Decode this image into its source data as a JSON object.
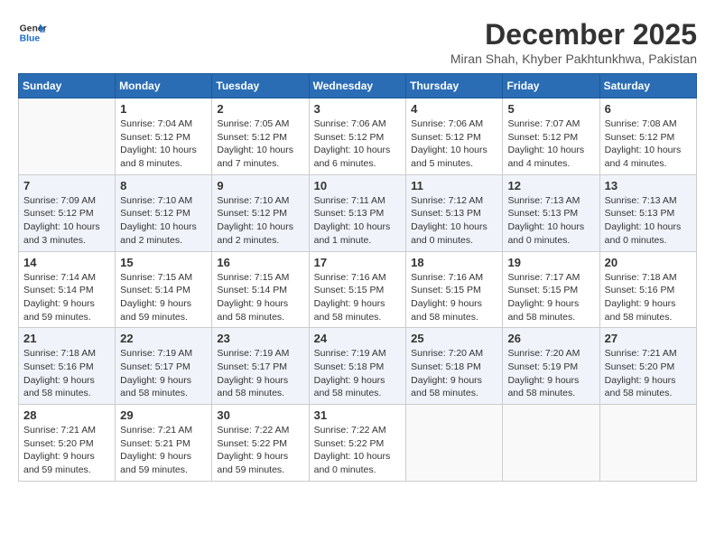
{
  "logo": {
    "line1": "General",
    "line2": "Blue"
  },
  "title": "December 2025",
  "subtitle": "Miran Shah, Khyber Pakhtunkhwa, Pakistan",
  "days_of_week": [
    "Sunday",
    "Monday",
    "Tuesday",
    "Wednesday",
    "Thursday",
    "Friday",
    "Saturday"
  ],
  "weeks": [
    [
      {
        "day": "",
        "info": ""
      },
      {
        "day": "1",
        "info": "Sunrise: 7:04 AM\nSunset: 5:12 PM\nDaylight: 10 hours\nand 8 minutes."
      },
      {
        "day": "2",
        "info": "Sunrise: 7:05 AM\nSunset: 5:12 PM\nDaylight: 10 hours\nand 7 minutes."
      },
      {
        "day": "3",
        "info": "Sunrise: 7:06 AM\nSunset: 5:12 PM\nDaylight: 10 hours\nand 6 minutes."
      },
      {
        "day": "4",
        "info": "Sunrise: 7:06 AM\nSunset: 5:12 PM\nDaylight: 10 hours\nand 5 minutes."
      },
      {
        "day": "5",
        "info": "Sunrise: 7:07 AM\nSunset: 5:12 PM\nDaylight: 10 hours\nand 4 minutes."
      },
      {
        "day": "6",
        "info": "Sunrise: 7:08 AM\nSunset: 5:12 PM\nDaylight: 10 hours\nand 4 minutes."
      }
    ],
    [
      {
        "day": "7",
        "info": "Sunrise: 7:09 AM\nSunset: 5:12 PM\nDaylight: 10 hours\nand 3 minutes."
      },
      {
        "day": "8",
        "info": "Sunrise: 7:10 AM\nSunset: 5:12 PM\nDaylight: 10 hours\nand 2 minutes."
      },
      {
        "day": "9",
        "info": "Sunrise: 7:10 AM\nSunset: 5:12 PM\nDaylight: 10 hours\nand 2 minutes."
      },
      {
        "day": "10",
        "info": "Sunrise: 7:11 AM\nSunset: 5:13 PM\nDaylight: 10 hours\nand 1 minute."
      },
      {
        "day": "11",
        "info": "Sunrise: 7:12 AM\nSunset: 5:13 PM\nDaylight: 10 hours\nand 0 minutes."
      },
      {
        "day": "12",
        "info": "Sunrise: 7:13 AM\nSunset: 5:13 PM\nDaylight: 10 hours\nand 0 minutes."
      },
      {
        "day": "13",
        "info": "Sunrise: 7:13 AM\nSunset: 5:13 PM\nDaylight: 10 hours\nand 0 minutes."
      }
    ],
    [
      {
        "day": "14",
        "info": "Sunrise: 7:14 AM\nSunset: 5:14 PM\nDaylight: 9 hours\nand 59 minutes."
      },
      {
        "day": "15",
        "info": "Sunrise: 7:15 AM\nSunset: 5:14 PM\nDaylight: 9 hours\nand 59 minutes."
      },
      {
        "day": "16",
        "info": "Sunrise: 7:15 AM\nSunset: 5:14 PM\nDaylight: 9 hours\nand 58 minutes."
      },
      {
        "day": "17",
        "info": "Sunrise: 7:16 AM\nSunset: 5:15 PM\nDaylight: 9 hours\nand 58 minutes."
      },
      {
        "day": "18",
        "info": "Sunrise: 7:16 AM\nSunset: 5:15 PM\nDaylight: 9 hours\nand 58 minutes."
      },
      {
        "day": "19",
        "info": "Sunrise: 7:17 AM\nSunset: 5:15 PM\nDaylight: 9 hours\nand 58 minutes."
      },
      {
        "day": "20",
        "info": "Sunrise: 7:18 AM\nSunset: 5:16 PM\nDaylight: 9 hours\nand 58 minutes."
      }
    ],
    [
      {
        "day": "21",
        "info": "Sunrise: 7:18 AM\nSunset: 5:16 PM\nDaylight: 9 hours\nand 58 minutes."
      },
      {
        "day": "22",
        "info": "Sunrise: 7:19 AM\nSunset: 5:17 PM\nDaylight: 9 hours\nand 58 minutes."
      },
      {
        "day": "23",
        "info": "Sunrise: 7:19 AM\nSunset: 5:17 PM\nDaylight: 9 hours\nand 58 minutes."
      },
      {
        "day": "24",
        "info": "Sunrise: 7:19 AM\nSunset: 5:18 PM\nDaylight: 9 hours\nand 58 minutes."
      },
      {
        "day": "25",
        "info": "Sunrise: 7:20 AM\nSunset: 5:18 PM\nDaylight: 9 hours\nand 58 minutes."
      },
      {
        "day": "26",
        "info": "Sunrise: 7:20 AM\nSunset: 5:19 PM\nDaylight: 9 hours\nand 58 minutes."
      },
      {
        "day": "27",
        "info": "Sunrise: 7:21 AM\nSunset: 5:20 PM\nDaylight: 9 hours\nand 58 minutes."
      }
    ],
    [
      {
        "day": "28",
        "info": "Sunrise: 7:21 AM\nSunset: 5:20 PM\nDaylight: 9 hours\nand 59 minutes."
      },
      {
        "day": "29",
        "info": "Sunrise: 7:21 AM\nSunset: 5:21 PM\nDaylight: 9 hours\nand 59 minutes."
      },
      {
        "day": "30",
        "info": "Sunrise: 7:22 AM\nSunset: 5:22 PM\nDaylight: 9 hours\nand 59 minutes."
      },
      {
        "day": "31",
        "info": "Sunrise: 7:22 AM\nSunset: 5:22 PM\nDaylight: 10 hours\nand 0 minutes."
      },
      {
        "day": "",
        "info": ""
      },
      {
        "day": "",
        "info": ""
      },
      {
        "day": "",
        "info": ""
      }
    ]
  ]
}
